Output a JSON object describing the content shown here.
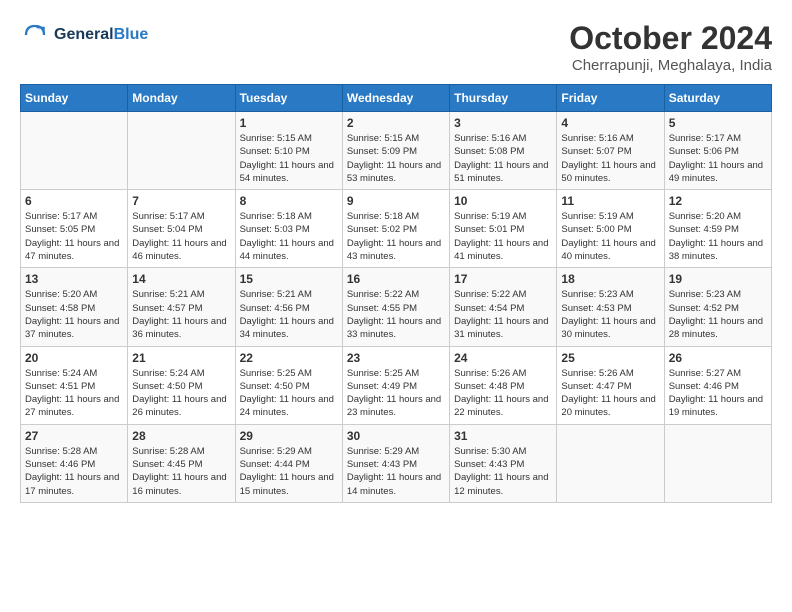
{
  "logo": {
    "line1": "General",
    "line2": "Blue"
  },
  "title": "October 2024",
  "location": "Cherrapunji, Meghalaya, India",
  "weekdays": [
    "Sunday",
    "Monday",
    "Tuesday",
    "Wednesday",
    "Thursday",
    "Friday",
    "Saturday"
  ],
  "weeks": [
    [
      null,
      null,
      {
        "day": "1",
        "sunrise": "5:15 AM",
        "sunset": "5:10 PM",
        "daylight": "11 hours and 54 minutes."
      },
      {
        "day": "2",
        "sunrise": "5:15 AM",
        "sunset": "5:09 PM",
        "daylight": "11 hours and 53 minutes."
      },
      {
        "day": "3",
        "sunrise": "5:16 AM",
        "sunset": "5:08 PM",
        "daylight": "11 hours and 51 minutes."
      },
      {
        "day": "4",
        "sunrise": "5:16 AM",
        "sunset": "5:07 PM",
        "daylight": "11 hours and 50 minutes."
      },
      {
        "day": "5",
        "sunrise": "5:17 AM",
        "sunset": "5:06 PM",
        "daylight": "11 hours and 49 minutes."
      }
    ],
    [
      {
        "day": "6",
        "sunrise": "5:17 AM",
        "sunset": "5:05 PM",
        "daylight": "11 hours and 47 minutes."
      },
      {
        "day": "7",
        "sunrise": "5:17 AM",
        "sunset": "5:04 PM",
        "daylight": "11 hours and 46 minutes."
      },
      {
        "day": "8",
        "sunrise": "5:18 AM",
        "sunset": "5:03 PM",
        "daylight": "11 hours and 44 minutes."
      },
      {
        "day": "9",
        "sunrise": "5:18 AM",
        "sunset": "5:02 PM",
        "daylight": "11 hours and 43 minutes."
      },
      {
        "day": "10",
        "sunrise": "5:19 AM",
        "sunset": "5:01 PM",
        "daylight": "11 hours and 41 minutes."
      },
      {
        "day": "11",
        "sunrise": "5:19 AM",
        "sunset": "5:00 PM",
        "daylight": "11 hours and 40 minutes."
      },
      {
        "day": "12",
        "sunrise": "5:20 AM",
        "sunset": "4:59 PM",
        "daylight": "11 hours and 38 minutes."
      }
    ],
    [
      {
        "day": "13",
        "sunrise": "5:20 AM",
        "sunset": "4:58 PM",
        "daylight": "11 hours and 37 minutes."
      },
      {
        "day": "14",
        "sunrise": "5:21 AM",
        "sunset": "4:57 PM",
        "daylight": "11 hours and 36 minutes."
      },
      {
        "day": "15",
        "sunrise": "5:21 AM",
        "sunset": "4:56 PM",
        "daylight": "11 hours and 34 minutes."
      },
      {
        "day": "16",
        "sunrise": "5:22 AM",
        "sunset": "4:55 PM",
        "daylight": "11 hours and 33 minutes."
      },
      {
        "day": "17",
        "sunrise": "5:22 AM",
        "sunset": "4:54 PM",
        "daylight": "11 hours and 31 minutes."
      },
      {
        "day": "18",
        "sunrise": "5:23 AM",
        "sunset": "4:53 PM",
        "daylight": "11 hours and 30 minutes."
      },
      {
        "day": "19",
        "sunrise": "5:23 AM",
        "sunset": "4:52 PM",
        "daylight": "11 hours and 28 minutes."
      }
    ],
    [
      {
        "day": "20",
        "sunrise": "5:24 AM",
        "sunset": "4:51 PM",
        "daylight": "11 hours and 27 minutes."
      },
      {
        "day": "21",
        "sunrise": "5:24 AM",
        "sunset": "4:50 PM",
        "daylight": "11 hours and 26 minutes."
      },
      {
        "day": "22",
        "sunrise": "5:25 AM",
        "sunset": "4:50 PM",
        "daylight": "11 hours and 24 minutes."
      },
      {
        "day": "23",
        "sunrise": "5:25 AM",
        "sunset": "4:49 PM",
        "daylight": "11 hours and 23 minutes."
      },
      {
        "day": "24",
        "sunrise": "5:26 AM",
        "sunset": "4:48 PM",
        "daylight": "11 hours and 22 minutes."
      },
      {
        "day": "25",
        "sunrise": "5:26 AM",
        "sunset": "4:47 PM",
        "daylight": "11 hours and 20 minutes."
      },
      {
        "day": "26",
        "sunrise": "5:27 AM",
        "sunset": "4:46 PM",
        "daylight": "11 hours and 19 minutes."
      }
    ],
    [
      {
        "day": "27",
        "sunrise": "5:28 AM",
        "sunset": "4:46 PM",
        "daylight": "11 hours and 17 minutes."
      },
      {
        "day": "28",
        "sunrise": "5:28 AM",
        "sunset": "4:45 PM",
        "daylight": "11 hours and 16 minutes."
      },
      {
        "day": "29",
        "sunrise": "5:29 AM",
        "sunset": "4:44 PM",
        "daylight": "11 hours and 15 minutes."
      },
      {
        "day": "30",
        "sunrise": "5:29 AM",
        "sunset": "4:43 PM",
        "daylight": "11 hours and 14 minutes."
      },
      {
        "day": "31",
        "sunrise": "5:30 AM",
        "sunset": "4:43 PM",
        "daylight": "11 hours and 12 minutes."
      },
      null,
      null
    ]
  ]
}
